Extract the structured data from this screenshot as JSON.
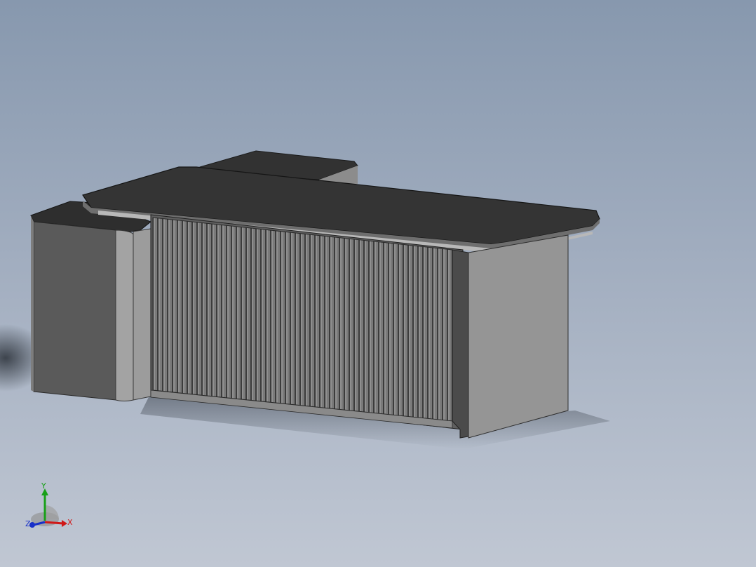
{
  "viewport": {
    "background_top": "#8798ae",
    "background_bottom": "#c0c7d3"
  },
  "model": {
    "top_color": "#333333",
    "side_light": "#9a9a9a",
    "side_dark": "#595959",
    "slat_color": "#6a6a6a"
  },
  "triad": {
    "x_label": "X",
    "y_label": "Y",
    "z_label": "Z",
    "x_color": "#d01818",
    "y_color": "#18a018",
    "z_color": "#1830c8"
  }
}
